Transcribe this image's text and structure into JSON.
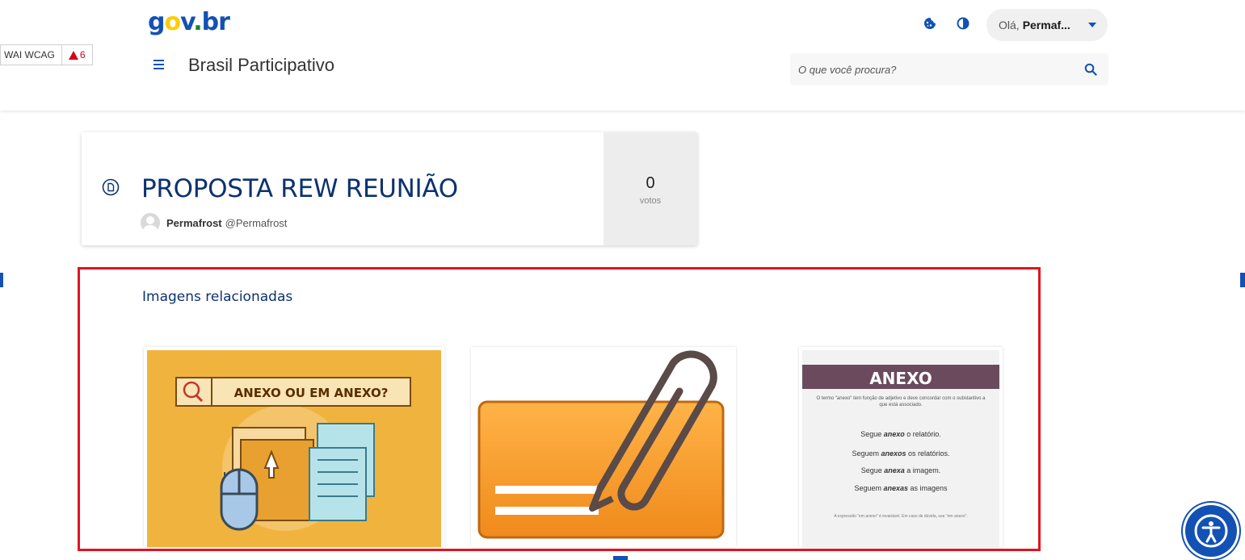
{
  "wai_badge": {
    "label": "WAI WCAG",
    "count": "6"
  },
  "header": {
    "logo": {
      "g": "g",
      "o": "o",
      "v": "v",
      "dot": ".",
      "br": "br"
    },
    "site_title": "Brasil Participativo",
    "user": {
      "greeting": "Olá,",
      "name": "Permaf..."
    },
    "search": {
      "placeholder": "O que você procura?"
    }
  },
  "proposal": {
    "title": "PROPOSTA REW REUNIÃO",
    "author_name": "Permafrost",
    "author_handle": "@Permafrost",
    "votes_count": "0",
    "votes_label": "votos"
  },
  "related_images": {
    "heading": "Imagens relacionadas",
    "images": [
      {
        "text": "ANEXO OU EM ANEXO?"
      },
      {
        "text": ""
      },
      {
        "title": "ANEXO",
        "intro": "O termo \"anexo\" tem função de adjetivo e deve concordar com o substantivo a que está associado.",
        "lines": [
          {
            "pre": "Segue ",
            "bold": "anexo",
            "post": " o relatório."
          },
          {
            "pre": "Seguem ",
            "bold": "anexos",
            "post": " os relatórios."
          },
          {
            "pre": "Segue ",
            "bold": "anexa",
            "post": " a imagem."
          },
          {
            "pre": "Seguem ",
            "bold": "anexas",
            "post": " as imagens"
          }
        ],
        "footer": "A expressão \"em anexo\" é invariável. Em caso de dúvida, use \"em anexo\"."
      }
    ]
  },
  "colors": {
    "primary": "#1351b4",
    "title": "#0c326f",
    "highlight_border": "#e0141e"
  }
}
